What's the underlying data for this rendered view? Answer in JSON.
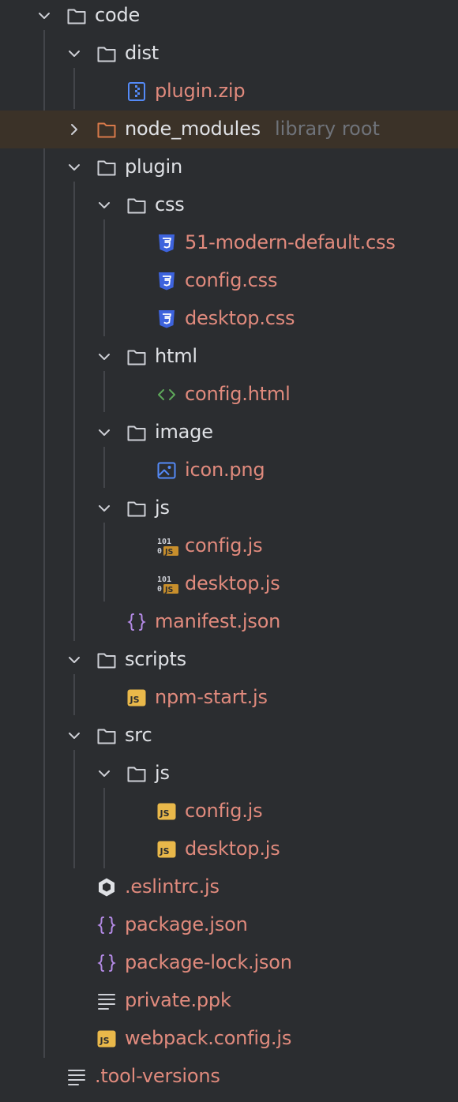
{
  "tree": {
    "root": {
      "label": "code"
    },
    "dist": {
      "label": "dist"
    },
    "plugin_zip": {
      "label": "plugin.zip"
    },
    "node_modules": {
      "label": "node_modules",
      "extra": "library root"
    },
    "plugin": {
      "label": "plugin"
    },
    "css": {
      "label": "css"
    },
    "css_modern": {
      "label": "51-modern-default.css"
    },
    "css_config": {
      "label": "config.css"
    },
    "css_desktop": {
      "label": "desktop.css"
    },
    "html": {
      "label": "html"
    },
    "html_config": {
      "label": "config.html"
    },
    "image": {
      "label": "image"
    },
    "image_icon": {
      "label": "icon.png"
    },
    "plugin_js": {
      "label": "js"
    },
    "plugin_js_config": {
      "label": "config.js",
      "badge_top": "101",
      "badge_bottom": "0",
      "badge_js": "JS"
    },
    "plugin_js_desktop": {
      "label": "desktop.js",
      "badge_top": "101",
      "badge_bottom": "0",
      "badge_js": "JS"
    },
    "manifest": {
      "label": "manifest.json"
    },
    "scripts": {
      "label": "scripts"
    },
    "npm_start": {
      "label": "npm-start.js",
      "badge": "JS"
    },
    "src": {
      "label": "src"
    },
    "src_js": {
      "label": "js"
    },
    "src_js_config": {
      "label": "config.js",
      "badge": "JS"
    },
    "src_js_desktop": {
      "label": "desktop.js",
      "badge": "JS"
    },
    "eslintrc": {
      "label": ".eslintrc.js"
    },
    "package_json": {
      "label": "package.json"
    },
    "package_lock": {
      "label": "package-lock.json"
    },
    "private_ppk": {
      "label": "private.ppk"
    },
    "webpack": {
      "label": "webpack.config.js",
      "badge": "JS"
    },
    "tool_versions": {
      "label": ".tool-versions"
    }
  },
  "colors": {
    "background": "#2b2d30",
    "highlight_row": "#3b3228",
    "directory_text": "#dfe1e5",
    "file_text": "#e08a7d",
    "muted_text": "#6f737a",
    "css_icon": "#3d63dd",
    "js_badge": "#e9b84a",
    "json_icon": "#b48ae6",
    "html_icon": "#5ea85a",
    "image_icon": "#548af7"
  }
}
